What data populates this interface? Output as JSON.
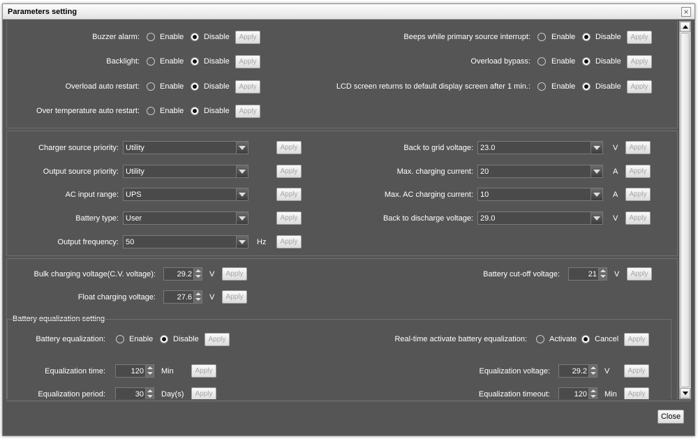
{
  "window": {
    "title": "Parameters setting",
    "close_icon": "×"
  },
  "common": {
    "enable": "Enable",
    "disable": "Disable",
    "apply": "Apply",
    "activate": "Activate",
    "cancel": "Cancel"
  },
  "toggles": {
    "buzzer_alarm": {
      "label": "Buzzer alarm:",
      "selected": "Disable"
    },
    "backlight": {
      "label": "Backlight:",
      "selected": "Disable"
    },
    "overload_auto_restart": {
      "label": "Overload auto restart:",
      "selected": "Disable"
    },
    "over_temperature_auto_restart": {
      "label": "Over temperature auto restart:",
      "selected": "Disable"
    },
    "beeps_primary_interrupt": {
      "label": "Beeps while primary source interrupt:",
      "selected": "Disable"
    },
    "overload_bypass": {
      "label": "Overload bypass:",
      "selected": "Disable"
    },
    "lcd_return_default": {
      "label": "LCD screen returns to default display screen after 1 min.:",
      "selected": "Disable"
    }
  },
  "selects": {
    "charger_source_priority": {
      "label": "Charger source priority:",
      "value": "Utility"
    },
    "output_source_priority": {
      "label": "Output source priority:",
      "value": "Utility"
    },
    "ac_input_range": {
      "label": "AC input range:",
      "value": "UPS"
    },
    "battery_type": {
      "label": "Battery type:",
      "value": "User"
    },
    "output_frequency": {
      "label": "Output frequency:",
      "value": "50",
      "unit": "Hz"
    },
    "back_to_grid_voltage": {
      "label": "Back to grid voltage:",
      "value": "23.0",
      "unit": "V"
    },
    "max_charging_current": {
      "label": "Max. charging current:",
      "value": "20",
      "unit": "A"
    },
    "max_ac_charging_current": {
      "label": "Max. AC charging current:",
      "value": "10",
      "unit": "A"
    },
    "back_to_discharge_voltage": {
      "label": "Back to discharge voltage:",
      "value": "29.0",
      "unit": "V"
    }
  },
  "spinners": {
    "bulk_charging_voltage": {
      "label": "Bulk charging voltage(C.V. voltage):",
      "value": "29.2",
      "unit": "V"
    },
    "float_charging_voltage": {
      "label": "Float charging voltage:",
      "value": "27.6",
      "unit": "V"
    },
    "battery_cutoff_voltage": {
      "label": "Battery cut-off voltage:",
      "value": "21",
      "unit": "V"
    }
  },
  "equalization": {
    "group_title": "Battery equalization setting",
    "battery_equalization": {
      "label": "Battery equalization:",
      "selected": "Disable"
    },
    "realtime_activate": {
      "label": "Real-time activate battery equalization:",
      "selected": "Cancel"
    },
    "equalization_time": {
      "label": "Equalization time:",
      "value": "120",
      "unit": "Min"
    },
    "equalization_period": {
      "label": "Equalization period:",
      "value": "30",
      "unit": "Day(s)"
    },
    "equalization_voltage": {
      "label": "Equalization voltage:",
      "value": "29.2",
      "unit": "V"
    },
    "equalization_timeout": {
      "label": "Equalization timeout:",
      "value": "120",
      "unit": "Min"
    }
  },
  "footer": {
    "close_label": "Close"
  }
}
